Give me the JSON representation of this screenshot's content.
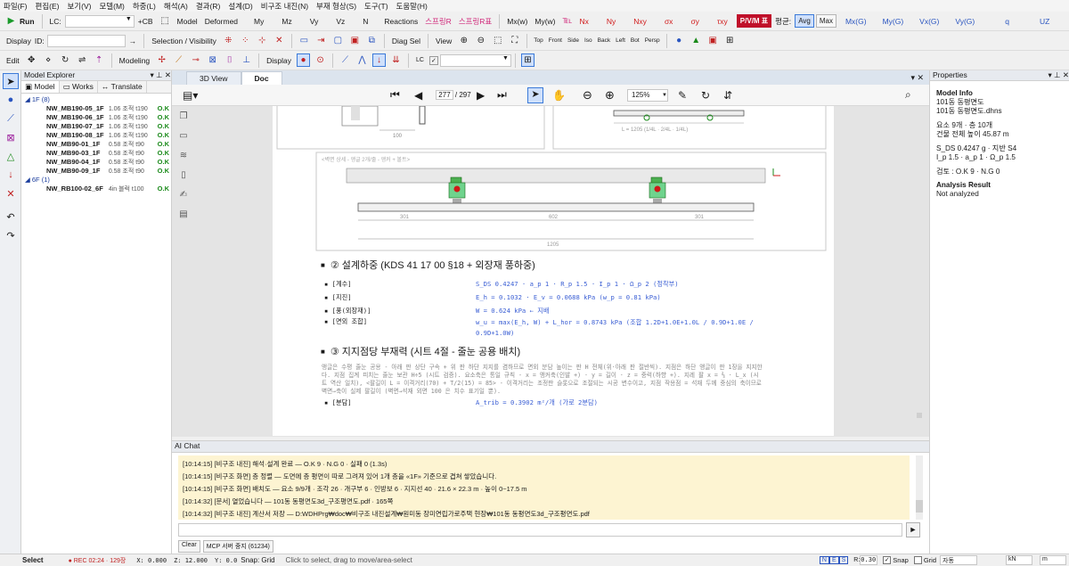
{
  "menu": [
    "파일(F)",
    "편집(E)",
    "보기(V)",
    "모델(M)",
    "하중(L)",
    "해석(A)",
    "결과(R)",
    "설계(D)",
    "비구조 내진(N)",
    "부재 형상(S)",
    "도구(T)",
    "도움말(H)"
  ],
  "toolbar1": {
    "run": "Run",
    "lc_label": "LC:",
    "cb": "+CB",
    "items_a": [
      "Model",
      "Deformed",
      "My",
      "Mz",
      "Vy",
      "Vz",
      "N",
      "Reactions"
    ],
    "spring1": "스프링R",
    "spring2": "스프링R표",
    "items_b": [
      "Mx(w)",
      "My(w)"
    ],
    "stress": [
      "Nx",
      "Ny",
      "Nxy",
      "σx",
      "σy",
      "τxy"
    ],
    "pvm": "P/V/M 표",
    "avg_label": "평균:",
    "avg": "Avg",
    "max": "Max",
    "items_c": [
      "Mx(G)",
      "My(G)",
      "Vx(G)",
      "Vy(G)",
      "q",
      "UZ"
    ]
  },
  "toolbar2": {
    "display": "Display",
    "id_label": "ID:",
    "arrow": "→",
    "selvis": "Selection / Visibility",
    "diag": "Diag Sel",
    "view": "View",
    "views": [
      "Top",
      "Front",
      "Side",
      "Iso",
      "Back",
      "Left",
      "Bot",
      "Persp"
    ]
  },
  "toolbar3": {
    "edit": "Edit",
    "modeling": "Modeling",
    "display": "Display",
    "lc": "LC"
  },
  "explorer": {
    "title": "Model Explorer",
    "tabs": [
      "Model",
      "Works",
      "Translate"
    ],
    "groups": [
      {
        "label": "1F (8)",
        "rows": [
          [
            "NW_MB190-05_1F",
            "1.06 조적 t190",
            "O.K"
          ],
          [
            "NW_MB190-06_1F",
            "1.06 조적 t190",
            "O.K"
          ],
          [
            "NW_MB190-07_1F",
            "1.06 조적 t190",
            "O.K"
          ],
          [
            "NW_MB190-08_1F",
            "1.06 조적 t190",
            "O.K"
          ],
          [
            "NW_MB90-01_1F",
            "0.58 조적 t90",
            "O.K"
          ],
          [
            "NW_MB90-03_1F",
            "0.58 조적 t90",
            "O.K"
          ],
          [
            "NW_MB90-04_1F",
            "0.58 조적 t90",
            "O.K"
          ],
          [
            "NW_MB90-09_1F",
            "0.58 조적 t90",
            "O.K"
          ]
        ]
      },
      {
        "label": "6F (1)",
        "rows": [
          [
            "NW_RB100-02_6F",
            "4in 블럭 t100",
            "O.K"
          ]
        ]
      }
    ]
  },
  "center": {
    "tabs": [
      "3D View",
      "Doc"
    ],
    "page_current": "277",
    "page_total": "/ 297",
    "zoom": "125%"
  },
  "doc": {
    "fig_top_left": "100",
    "fig_top_right": "L = 1205   (1/4L · 2/4L · 1/4L)",
    "fig_caption": "<벽면 상세 - 앵글 2개/줄 - 앵커 + 볼트>",
    "dims": [
      "301",
      "602",
      "301",
      "1205"
    ],
    "s2_title": "② 설계하중 (KDS 41 17 00 §18 + 외장재 풍하중)",
    "s2_rows": [
      [
        "[계수]",
        "S_DS 0.4247 · a_p 1 · R_p 1.5 · I_p 1 · Ω_p 2 (정착부)"
      ],
      [
        "[지진]",
        "E_h = 0.1032 · E_v = 0.0688 kPa  (w_p = 0.81 kPa)"
      ],
      [
        "[풍(외장재)]",
        "W = 0.624 kPa  ← 지배"
      ],
      [
        "[면외 조합]",
        "w_u = max(E_h, W) + L_hor = 0.8743 kPa  (조합 1.2D+1.0E+1.0L / 0.9D+1.0E / 0.9D+1.0W)"
      ]
    ],
    "s3_title": "③ 지지점당 부재력 (시트 4절 - 줄눈 공용 배치)",
    "s3_para": "앵글은 수평 줄눈 공용 - 아래 판 상단 구속 + 위 판 하단 지지를 겸하므로 면외 분담 높이는 판 H 전체(위·아래 판 절반씩). 지점은 하단 앵글이 판 1장을 지지한다. 지점 집계 피치는 줄눈 보관 H÷5 (시트 검증). 요소축은 통일 규칙 - x = 앵커축(인발 +) · y = 길이 · z = 중력(하향 +). 지레 팔 x = ⅔ · L_x (시트 역산 일치), <팔길이 L = 이격거리(70) + T/2(15) = 85> - 이격거리는 조정판 슬롯으로 조절되는 시공 변수이고, 지점 작용점 = 석재 두께 중심의 축이므로 벽면→축이 실제 팔길이 (벽면→석재 외면 100 은 치수 표기일 뿐).",
    "s3_next": "[분담]",
    "s3_next_val": "A_trib = 0.3902 m²/개 (가로 2분담)"
  },
  "properties": {
    "title": "Properties",
    "model_info": "Model Info",
    "name1": "101동 동평면도",
    "name2": "101동 동평면도.dhns",
    "elements": "요소 9개 · 층 10개",
    "height": "건물 전체 높이 45.87 m",
    "sds": "S_DS 0.4247 g · 지반 S4",
    "ip": "I_p 1.5 · a_p 1 · Ω_p 1.5",
    "check": "검토 : O.K 9 · N.G 0",
    "analysis": "Analysis Result",
    "not_analyzed": "Not analyzed"
  },
  "chat": {
    "title": "AI Chat",
    "lines": [
      "[10:14:15] [비구조 내진] 해석·설계 완료 — O.K 9 · N.G 0 · 실패 0 (1.3s)",
      "[10:14:15] [비구조 화면] 층 정렬 — 도면에 층 평면이 따로 그려져 있어 1개 층을 «1F» 기준으로 겹쳐 쌓았습니다.",
      "[10:14:15] [비구조 화면] 배치도 — 요소 9/9개 · 조각 26 · 개구부 6 · 인방보 6 · 지지선 40 · 21.6 × 22.3 m · 높이 0~17.5 m",
      "[10:14:32] [문서] 열었습니다 — 101동 동평면도3d_구조평면도.pdf · 165쪽",
      "[10:14:32] [비구조 내진] 계산서 저장 — D:WDHPrg₩doc₩비구조 내진설계₩원미동 장미연립가로주택 현장₩101동 동평면도3d_구조평면도.pdf"
    ],
    "clear": "Clear",
    "mcp": "MCP 서버 중지 (61234)",
    "send": "►"
  },
  "status": {
    "mode": "Select",
    "rec": "● REC 02:24 · 129장",
    "x": "X: 0.000",
    "z": "Z: 12.000",
    "y": "Y: 0.0",
    "snap": "Snap: Grid",
    "hint": "Click to select, drag to move/area-select",
    "nes": [
      "N",
      "E",
      "S"
    ],
    "r": "R:",
    "rval": "0.30",
    "snap2": "Snap",
    "grid": "Grid",
    "auto": "자동",
    "unit1": "kN",
    "unit2": "m"
  },
  "colors": {
    "accent": "#2a55c0",
    "pvm": "#c0102a",
    "ok": "#1a8a1a",
    "chat_bg": "#fdf4d2"
  }
}
